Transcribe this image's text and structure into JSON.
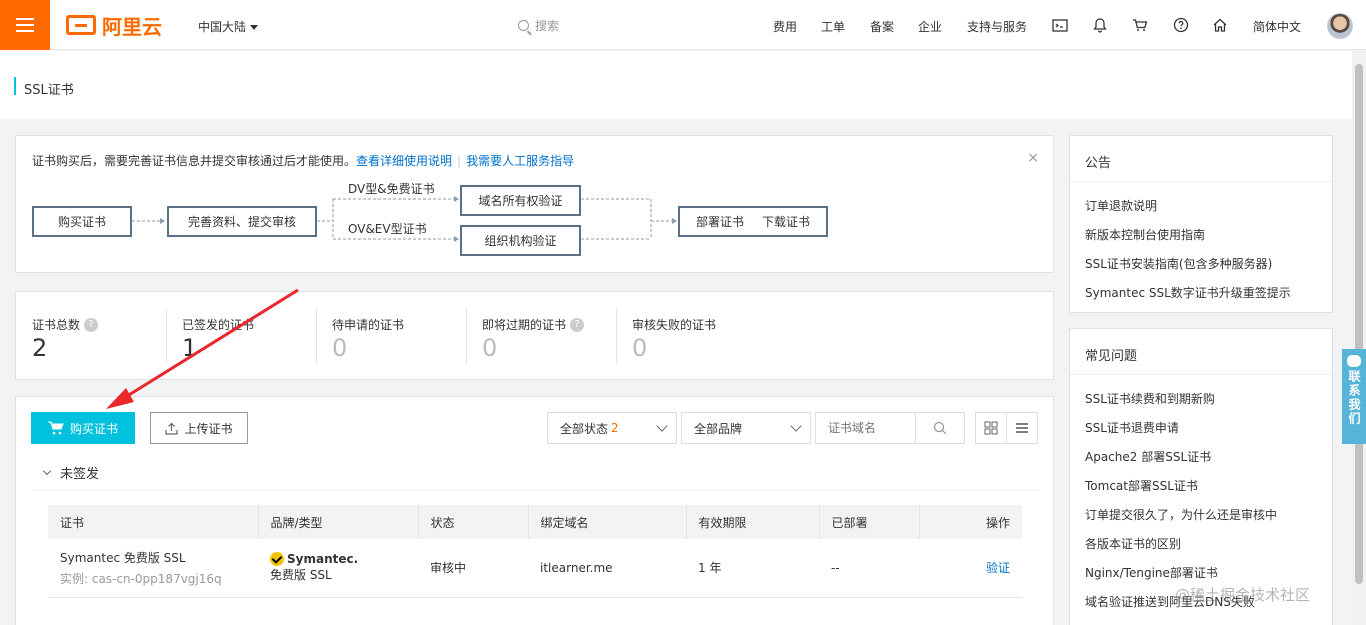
{
  "header": {
    "logo_text": "阿里云",
    "region": "中国大陆",
    "search_placeholder": "搜索",
    "nav": [
      "费用",
      "工单",
      "备案",
      "企业",
      "支持与服务"
    ],
    "language": "简体中文"
  },
  "page": {
    "title": "SSL证书"
  },
  "notice": {
    "text": "证书购买后，需要完善证书信息并提交审核通过后才能使用。",
    "link1": "查看详细使用说明",
    "link2": "我需要人工服务指导",
    "close": "×"
  },
  "flow": {
    "buy": "购买证书",
    "complete": "完善资料、提交审核",
    "dv_label": "DV型&免费证书",
    "ov_label": "OV&EV型证书",
    "domain_verify": "域名所有权验证",
    "org_verify": "组织机构验证",
    "deploy": "部署证书",
    "download": "下载证书"
  },
  "stats": [
    {
      "label": "证书总数",
      "value": "2",
      "help": true
    },
    {
      "label": "已签发的证书",
      "value": "1",
      "help": false
    },
    {
      "label": "待申请的证书",
      "value": "0",
      "help": false
    },
    {
      "label": "即将过期的证书",
      "value": "0",
      "help": true
    },
    {
      "label": "审核失败的证书",
      "value": "0",
      "help": false
    }
  ],
  "toolbar": {
    "buy_label": "购买证书",
    "upload_label": "上传证书",
    "status_select": "全部状态",
    "status_count": "2",
    "brand_select": "全部品牌",
    "domain_placeholder": "证书域名"
  },
  "section": {
    "title": "未签发"
  },
  "table": {
    "headers": [
      "证书",
      "品牌/类型",
      "状态",
      "绑定域名",
      "有效期限",
      "已部署",
      "操作"
    ],
    "rows": [
      {
        "name": "Symantec 免费版 SSL",
        "instance": "实例: cas-cn-0pp187vgj16q",
        "brand": "Symantec.",
        "type": "免费版 SSL",
        "status": "审核中",
        "domain": "itlearner.me",
        "period": "1 年",
        "deployed": "--",
        "action": "验证"
      }
    ]
  },
  "announcements": {
    "title": "公告",
    "items": [
      "订单退款说明",
      "新版本控制台使用指南",
      "SSL证书安装指南(包含多种服务器)",
      "Symantec SSL数字证书升级重签提示"
    ]
  },
  "faq": {
    "title": "常见问题",
    "items": [
      "SSL证书续费和到期新购",
      "SSL证书退费申请",
      "Apache2 部署SSL证书",
      "Tomcat部署SSL证书",
      "订单提交很久了，为什么还是审核中",
      "各版本证书的区别",
      "Nginx/Tengine部署证书",
      "域名验证推送到阿里云DNS失败"
    ]
  },
  "contact": {
    "label": "联系我们"
  },
  "watermark": "@稀土掘金技术社区",
  "colors": {
    "brand": "#ff6a00",
    "accent": "#00c1de",
    "link": "#0070cc",
    "arrow": "#e8282b"
  }
}
